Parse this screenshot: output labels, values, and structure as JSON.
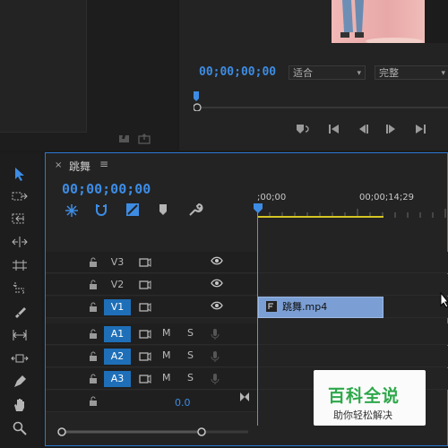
{
  "source_panel": {
    "icons": [
      "insert-overlay-icon",
      "export-frame-icon"
    ]
  },
  "program_monitor": {
    "timecode": "00;00;00;00",
    "fit_select": {
      "value": "适合"
    },
    "quality_select": {
      "value": "完整"
    },
    "transport": [
      "add-marker-icon",
      "step-back-icon",
      "play-back-icon",
      "play-forward-icon",
      "step-forward-icon"
    ]
  },
  "tools": [
    "selection-tool-icon",
    "track-select-tool-icon",
    "ripple-edit-tool-icon",
    "rolling-edit-tool-icon",
    "rate-stretch-tool-icon",
    "razor-tool-icon",
    "slip-tool-icon",
    "slide-tool-icon",
    "pen-tool-icon",
    "hand-tool-icon",
    "zoom-tool-icon"
  ],
  "timeline": {
    "tab_close": "×",
    "title": "跳舞",
    "menu": "≡",
    "timecode": "00;00;00;00",
    "ruler_left": ";00;00",
    "ruler_right": "00;00;14;29",
    "video_tracks": [
      {
        "name": "V3",
        "selected": false
      },
      {
        "name": "V2",
        "selected": false
      },
      {
        "name": "V1",
        "selected": true
      }
    ],
    "audio_tracks": [
      {
        "name": "A1",
        "m": "M",
        "s": "S"
      },
      {
        "name": "A2",
        "m": "M",
        "s": "S"
      },
      {
        "name": "A3",
        "m": "M",
        "s": "S"
      }
    ],
    "master_value": "0.0",
    "clip": {
      "label": "跳舞.mp4",
      "color": "#7b9fd4"
    }
  },
  "watermark": {
    "title": "百科全说",
    "subtitle": "助你轻松解决"
  },
  "colors": {
    "accent": "#3d8ce4",
    "track_selected": "#1e6fb8",
    "panel_border": "#2a78d4"
  }
}
